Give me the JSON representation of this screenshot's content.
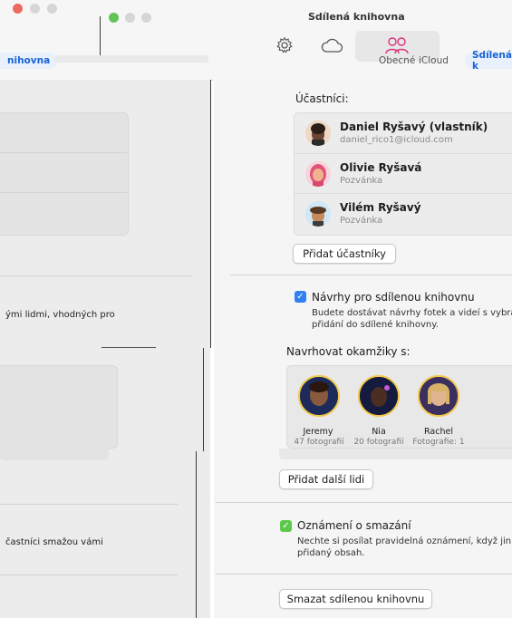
{
  "window": {
    "title_left": "Sdílená knihovna",
    "title_right": "Sdílená knihovna"
  },
  "toolbar": {
    "tabs": [
      {
        "name": "Obecné",
        "icon": "gear-icon"
      },
      {
        "name": "iCloud",
        "icon": "cloud-icon"
      },
      {
        "name": "Sdílená knihovna",
        "icon": "people-icon"
      }
    ],
    "segments": [
      "Obecné",
      "iCloud",
      "Sdílená k"
    ],
    "left_segment": "nihovna"
  },
  "left": {
    "text_1": "ými lidmi, vhodných pro",
    "text_2": "častníci smažou vámi"
  },
  "participants": {
    "label": "Účastníci:",
    "people": [
      {
        "name": "Daniel Ryšavý (vlastník)",
        "sub": "daniel_rico1@icloud.com",
        "avatar_color": "#7a4b3a"
      },
      {
        "name": "Olivie Ryšavá",
        "sub": "Pozvánka",
        "avatar_color": "#e0557a"
      },
      {
        "name": "Vilém Ryšavý",
        "sub": "Pozvánka",
        "avatar_color": "#9ecbe8"
      }
    ],
    "add_button": "Přidat účastníky"
  },
  "suggestions": {
    "checkbox_label": "Návrhy pro sdílenou knihovnu",
    "desc_line1": "Budete dostávat návrhy fotek a videí s vybran",
    "desc_line2": "přidání do sdílené knihovny.",
    "checked": true,
    "moments_label": "Navrhovat okamžiky s:",
    "people": [
      {
        "name": "Jeremy",
        "count": "47 fotografií"
      },
      {
        "name": "Nia",
        "count": "20 fotografií"
      },
      {
        "name": "Rachel",
        "count": "Fotografie: 1"
      }
    ],
    "add_more_button": "Přidat další lidi"
  },
  "deletion": {
    "checkbox_label": "Oznámení o smazání",
    "desc_line1": "Nechte si posílat pravidelná oznámení, když jiní úč",
    "desc_line2": "přidaný obsah.",
    "checked": true
  },
  "delete_button": "Smazat sdílenou knihovnu",
  "colors": {
    "accent": "#1a63d6",
    "check_blue": "#2f7ff5",
    "check_green": "#5dc94a",
    "people_tab_icon": "#e0307b"
  }
}
